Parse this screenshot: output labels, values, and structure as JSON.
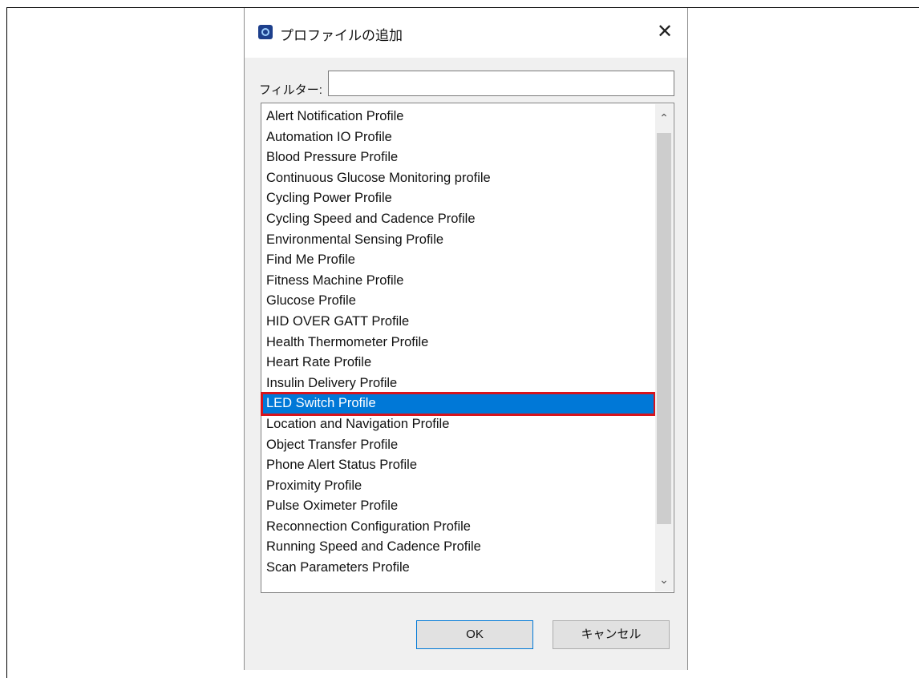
{
  "dialog": {
    "title": "プロファイルの追加",
    "close_glyph": "✕",
    "icon": "app-icon"
  },
  "filter": {
    "label": "フィルター:",
    "value": "",
    "placeholder": ""
  },
  "profiles": [
    "Alert Notification Profile",
    "Automation IO Profile",
    "Blood Pressure Profile",
    "Continuous Glucose Monitoring profile",
    "Cycling Power Profile",
    "Cycling Speed and Cadence Profile",
    "Environmental Sensing Profile",
    "Find Me Profile",
    "Fitness Machine Profile",
    "Glucose Profile",
    "HID OVER GATT Profile",
    "Health Thermometer Profile",
    "Heart Rate Profile",
    "Insulin Delivery Profile",
    "LED Switch Profile",
    "Location and Navigation Profile",
    "Object Transfer Profile",
    "Phone Alert Status Profile",
    "Proximity Profile",
    "Pulse Oximeter Profile",
    "Reconnection Configuration Profile",
    "Running Speed and Cadence Profile",
    "Scan Parameters Profile"
  ],
  "selected_index": 14,
  "scrollbar": {
    "up_glyph": "⌃",
    "down_glyph": "⌄"
  },
  "buttons": {
    "ok": "OK",
    "cancel": "キャンセル"
  },
  "colors": {
    "selection": "#0078d7",
    "highlight_border": "#d8141c"
  }
}
